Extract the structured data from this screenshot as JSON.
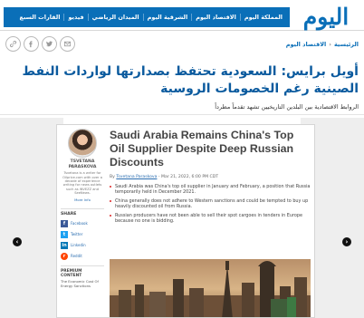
{
  "site": {
    "logo_text": "اليوم",
    "nav_items": [
      "المملكة اليوم",
      "الاقتصاد اليوم",
      "الشرقية اليوم",
      "الميدان الرياضي",
      "فيديو",
      "القارات السبع"
    ],
    "brand_color": "#0a6fb8"
  },
  "social_icons": [
    "link-icon",
    "facebook-icon",
    "twitter-icon",
    "email-icon"
  ],
  "breadcrumb": [
    "الرئيسية",
    "الاقتصاد اليوم"
  ],
  "headline": "أويل برايس: السعودية تحتفظ بصدارتها لواردات النفط الصينية رغم الخصومات الروسية",
  "subheadline": "الروابط الاقتصادية بين البلدين التاريخيين تشهد تقدماً مطرداً",
  "article_image": {
    "title": "Saudi Arabia Remains China's Top Oil Supplier Despite Deep Russian Discounts",
    "meta_prefix": "By",
    "meta_author": "Tsvetana Paraskova",
    "meta_date": "- Mar 21, 2022, 6:00 PM CDT",
    "bullets": [
      "Saudi Arabia was China's top oil supplier in January and February, a position that Russia temporarily held in December 2021.",
      "China generally does not adhere to Western sanctions and could be tempted to buy up heavily discounted oil from Russia.",
      "Russian producers have not been able to sell their spot cargoes in tenders in Europe because no one is bidding."
    ],
    "author_card": {
      "name_line1": "TSVETANA",
      "name_line2": "PARASKOVA",
      "bio": "Tsvetana is a writer for Oilprice.com with over a decade of experience writing for news outlets such as iNVEZZ and SeeNews.",
      "more": "More Info"
    },
    "share": {
      "title": "SHARE",
      "items": [
        {
          "label": "Facebook",
          "glyph": "f"
        },
        {
          "label": "Twitter",
          "glyph": "t"
        },
        {
          "label": "Linkedin",
          "glyph": "in"
        },
        {
          "label": "Reddit",
          "glyph": "r"
        }
      ]
    },
    "premium": {
      "title_line1": "PREMIUM",
      "title_line2": "CONTENT",
      "item": "The Economic Cost Of Energy Sanctions"
    }
  },
  "carousel": {
    "prev_glyph": "‹",
    "next_glyph": "›"
  }
}
